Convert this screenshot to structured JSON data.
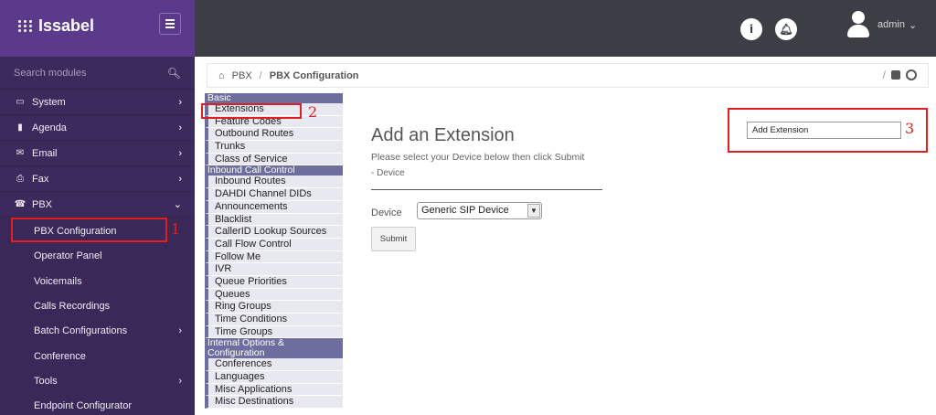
{
  "app": {
    "name": "Issabel"
  },
  "search": {
    "placeholder": "Search modules"
  },
  "sidebar": {
    "items": [
      {
        "label": "System"
      },
      {
        "label": "Agenda"
      },
      {
        "label": "Email"
      },
      {
        "label": "Fax"
      },
      {
        "label": "PBX"
      }
    ],
    "pbx_sub": [
      {
        "label": "PBX Configuration"
      },
      {
        "label": "Operator Panel"
      },
      {
        "label": "Voicemails"
      },
      {
        "label": "Calls Recordings"
      },
      {
        "label": "Batch Configurations"
      },
      {
        "label": "Conference"
      },
      {
        "label": "Tools"
      },
      {
        "label": "Endpoint Configurator"
      }
    ]
  },
  "topbar": {
    "user": "admin"
  },
  "breadcrumb": {
    "section": "PBX",
    "current": "PBX Configuration"
  },
  "module_menu": {
    "basic_header": "Basic",
    "basic": [
      "Extensions",
      "Feature Codes",
      "Outbound Routes",
      "Trunks",
      "Class of Service"
    ],
    "inbound_header": "Inbound Call Control",
    "inbound": [
      "Inbound Routes",
      "DAHDI Channel DIDs",
      "Announcements",
      "Blacklist",
      "CallerID Lookup Sources",
      "Call Flow Control",
      "Follow Me",
      "IVR",
      "Queue Priorities",
      "Queues",
      "Ring Groups",
      "Time Conditions",
      "Time Groups"
    ],
    "internal_header": "Internal Options & Configuration",
    "internal": [
      "Conferences",
      "Languages",
      "Misc Applications",
      "Misc Destinations"
    ]
  },
  "form": {
    "title": "Add an Extension",
    "description": "Please select your Device below then click Submit",
    "subtitle": "- Device",
    "device_label": "Device",
    "device_value": "Generic SIP Device",
    "submit_label": "Submit",
    "add_extension_label": "Add Extension"
  },
  "annotations": {
    "n1": "1",
    "n2": "2",
    "n3": "3"
  },
  "colors": {
    "sidebar_bg": "#3d2a5c",
    "logo_bg": "#5b3a8c",
    "topbar_bg": "#3b3e45",
    "menu_header": "#6e6e9e",
    "highlight": "#e02020"
  }
}
